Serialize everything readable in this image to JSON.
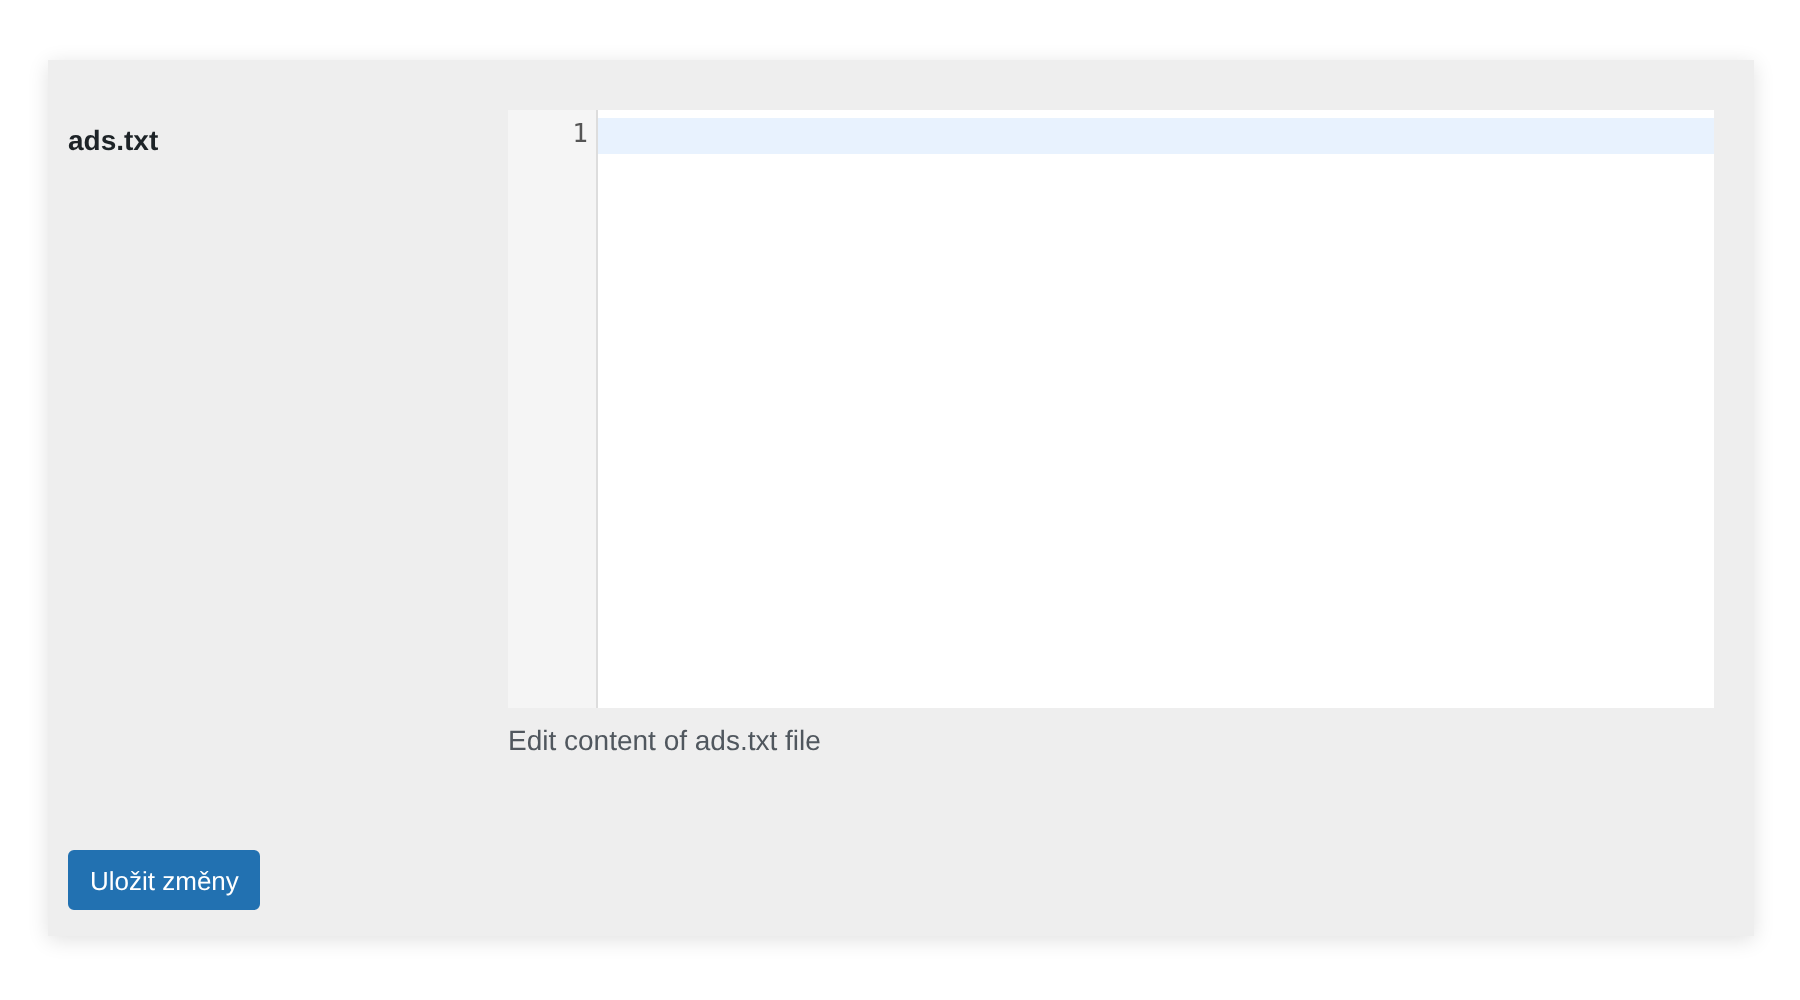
{
  "field": {
    "label": "ads.txt",
    "editor": {
      "lines": [
        {
          "number": "1",
          "active": true
        }
      ]
    },
    "help": "Edit content of ads.txt file"
  },
  "buttons": [
    {
      "label": "Uložit změny",
      "kind": "primary"
    }
  ]
}
